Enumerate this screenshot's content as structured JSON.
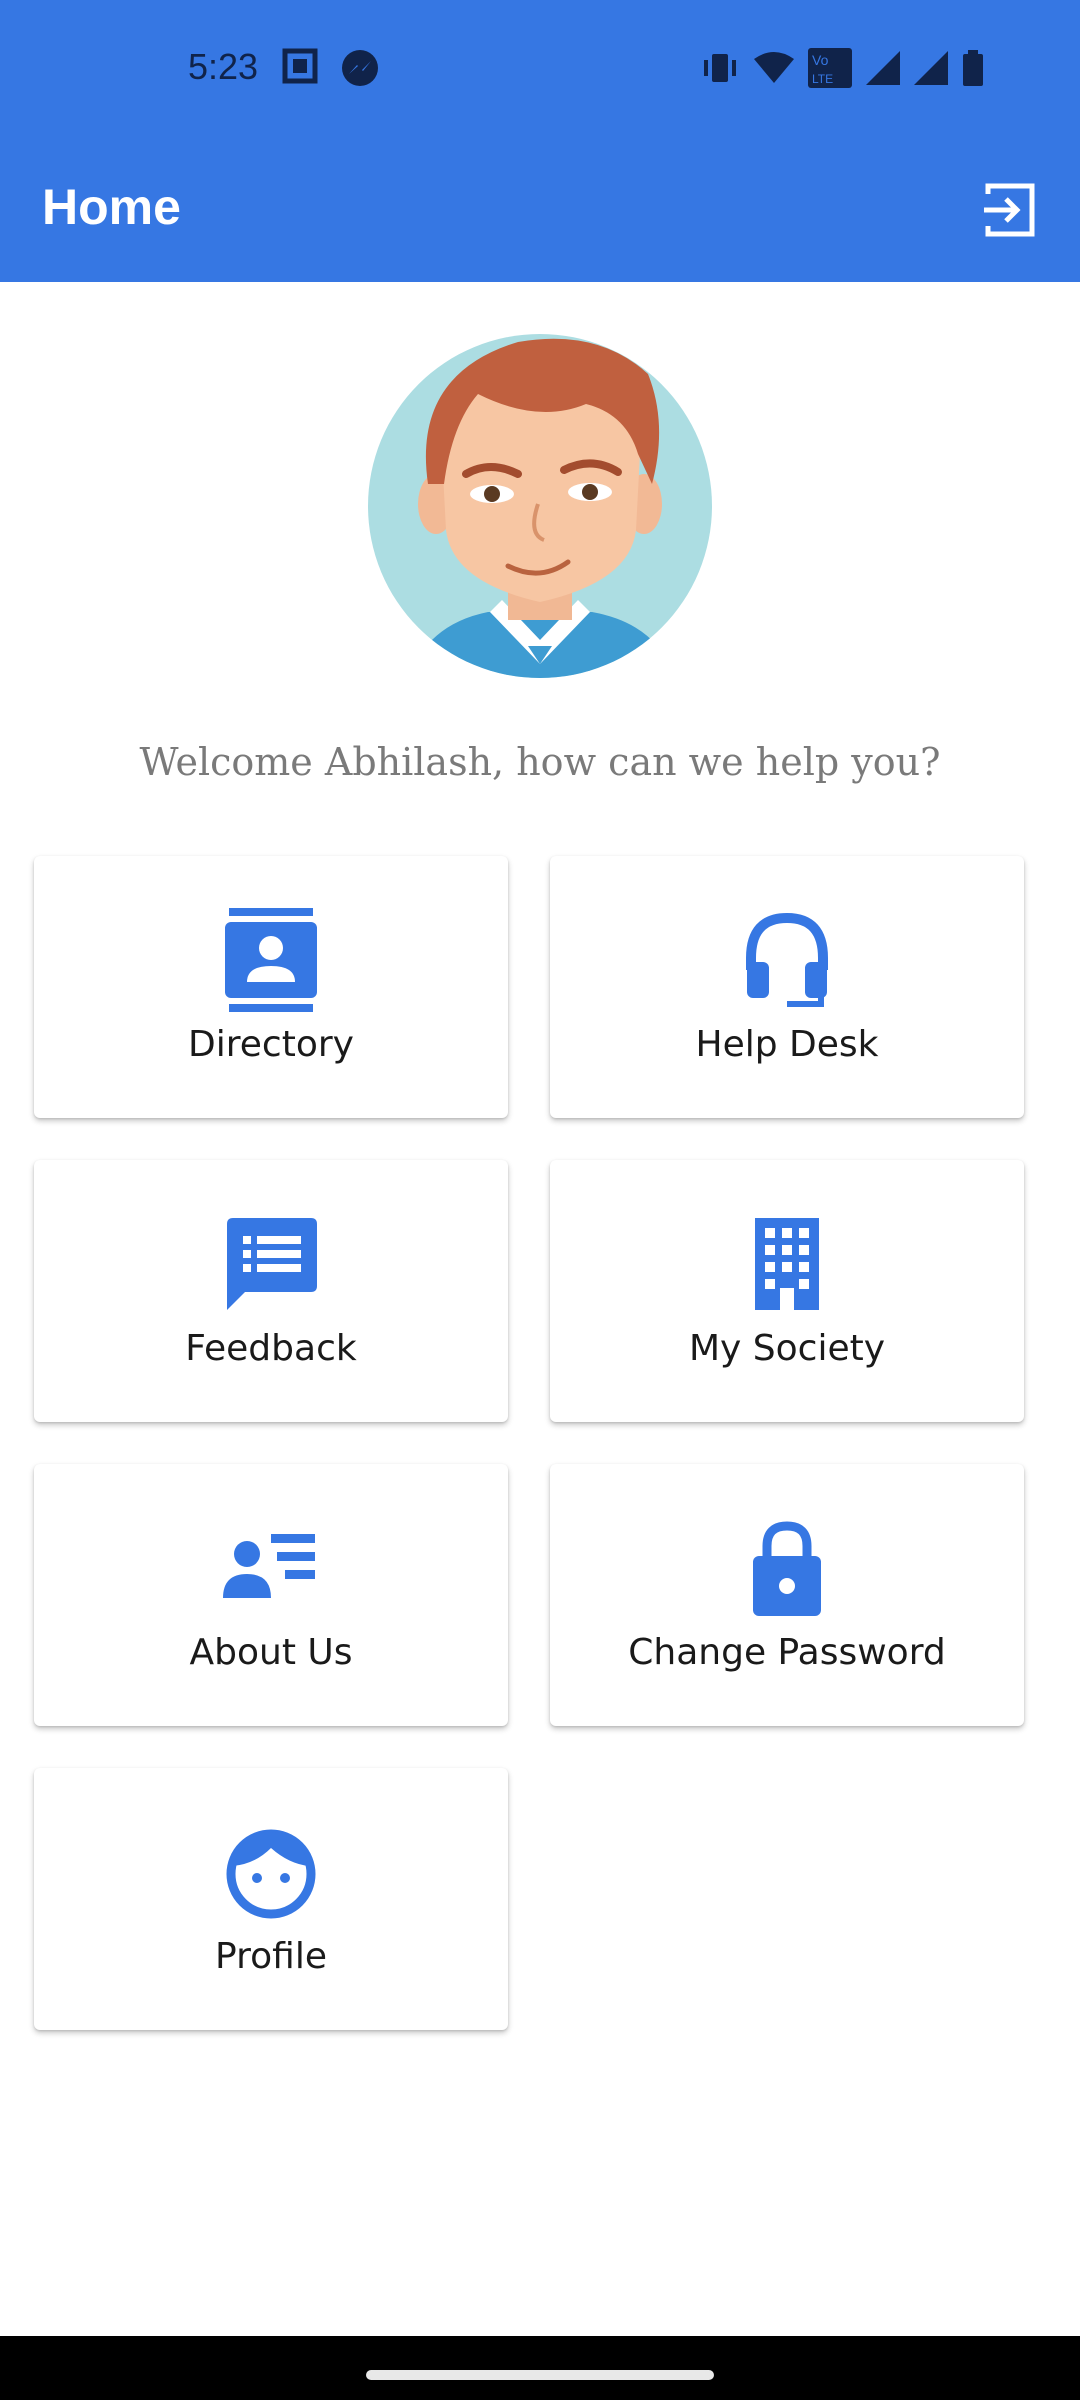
{
  "status_bar": {
    "time": "5:23",
    "left_icons": [
      "screenshot-icon",
      "messenger-icon"
    ],
    "right_icons": [
      "vibrate-icon",
      "wifi-icon",
      "volte-icon",
      "signal-icon",
      "signal-icon",
      "battery-icon"
    ]
  },
  "app_bar": {
    "title": "Home",
    "action_icon": "logout-icon"
  },
  "welcome_text": "Welcome Abhilash, how can we help you?",
  "menu": [
    {
      "label": "Directory",
      "icon": "contact-card-icon"
    },
    {
      "label": "Help Desk",
      "icon": "headset-icon"
    },
    {
      "label": "Feedback",
      "icon": "feedback-icon"
    },
    {
      "label": "My Society",
      "icon": "building-icon"
    },
    {
      "label": "About Us",
      "icon": "person-list-icon"
    },
    {
      "label": "Change Password",
      "icon": "lock-icon"
    },
    {
      "label": "Profile",
      "icon": "face-icon"
    }
  ],
  "colors": {
    "primary": "#3677e3",
    "card_background": "#ffffff",
    "text": "#1a1a1a",
    "welcome_text": "#7a7a7a"
  }
}
